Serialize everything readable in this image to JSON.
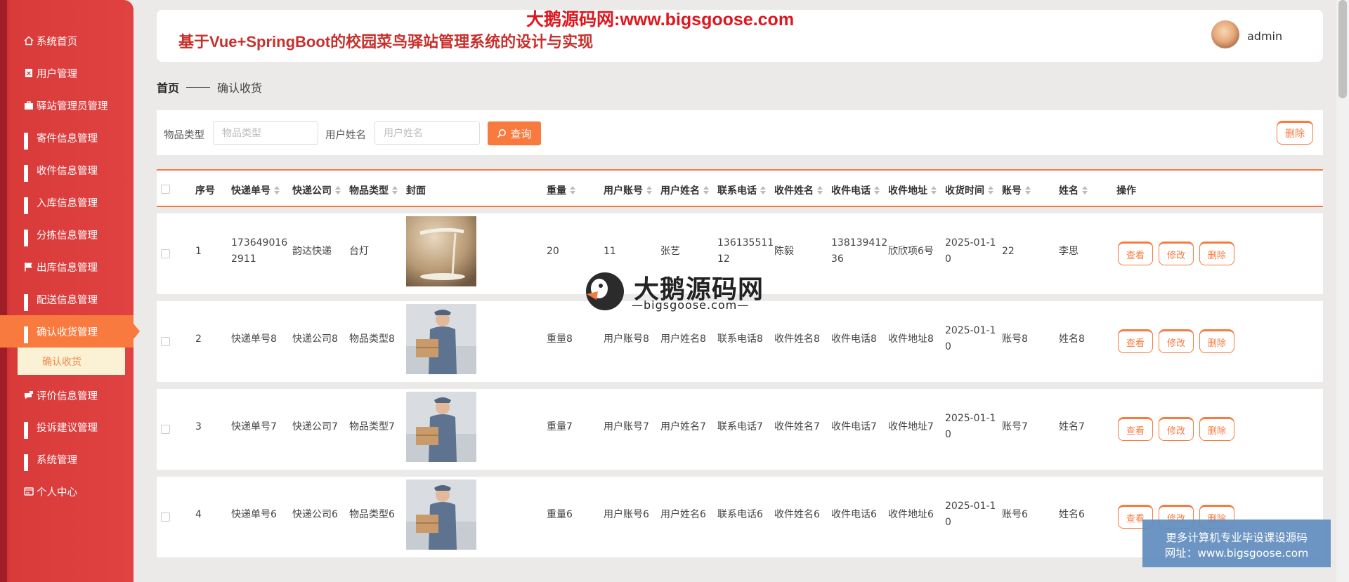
{
  "sidebar": {
    "items": [
      {
        "label": "系统首页",
        "icon": "home-icon"
      },
      {
        "label": "用户管理",
        "icon": "user-doc-icon"
      },
      {
        "label": "驿站管理员管理",
        "icon": "briefcase-icon"
      },
      {
        "label": "寄件信息管理",
        "icon": "grid-icon"
      },
      {
        "label": "收件信息管理",
        "icon": "grid-icon"
      },
      {
        "label": "入库信息管理",
        "icon": "grid-icon"
      },
      {
        "label": "分拣信息管理",
        "icon": "grid-icon"
      },
      {
        "label": "出库信息管理",
        "icon": "flag-icon"
      },
      {
        "label": "配送信息管理",
        "icon": "grid-icon"
      },
      {
        "label": "确认收货管理",
        "icon": "grid-icon"
      },
      {
        "label": "评价信息管理",
        "icon": "comment-icon"
      },
      {
        "label": "投诉建议管理",
        "icon": "grid-icon"
      },
      {
        "label": "系统管理",
        "icon": "grid-icon"
      },
      {
        "label": "个人中心",
        "icon": "card-icon"
      }
    ],
    "active_sub": "确认收货",
    "active_color": "#f97a3e"
  },
  "header": {
    "title": "基于Vue+SpringBoot的校园菜鸟驿站管理系统的设计与实现",
    "user": "admin"
  },
  "watermark": {
    "top": "大鹅源码网:www.bigsgoose.com",
    "center_title": "大鹅源码网",
    "center_sub": "—bigsgoose.com—",
    "box_line1": "更多计算机专业毕设课设源码",
    "box_line2": "网址：www.bigsgoose.com"
  },
  "breadcrumb": {
    "home": "首页",
    "current": "确认收货"
  },
  "search": {
    "type_label": "物品类型",
    "type_placeholder": "物品类型",
    "name_label": "用户姓名",
    "name_placeholder": "用户姓名",
    "query_label": "查询",
    "delete_label": "删除"
  },
  "table": {
    "headers": [
      "序号",
      "快递单号",
      "快递公司",
      "物品类型",
      "封面",
      "重量",
      "用户账号",
      "用户姓名",
      "联系电话",
      "收件姓名",
      "收件电话",
      "收件地址",
      "收货时间",
      "账号",
      "姓名",
      "操作"
    ],
    "rows": [
      {
        "no": "1",
        "tracking": [
          "173649016",
          "2911"
        ],
        "company": "韵达快递",
        "type": "台灯",
        "cover": "lamp",
        "weight": "20",
        "account": "11",
        "name": "张艺",
        "phone": [
          "136135511",
          "12"
        ],
        "rname": "陈毅",
        "rphone": [
          "138139412",
          "36"
        ],
        "raddr": "欣欣项6号",
        "time": [
          "2025-01-1",
          "0"
        ],
        "acct": "22",
        "person": "李思"
      },
      {
        "no": "2",
        "tracking": [
          "快递单号8"
        ],
        "company": "快递公司8",
        "type": "物品类型8",
        "cover": "courier",
        "weight": "重量8",
        "account": "用户账号8",
        "name": "用户姓名8",
        "phone": [
          "联系电话8"
        ],
        "rname": "收件姓名8",
        "rphone": [
          "收件电话8"
        ],
        "raddr": "收件地址8",
        "time": [
          "2025-01-1",
          "0"
        ],
        "acct": "账号8",
        "person": "姓名8"
      },
      {
        "no": "3",
        "tracking": [
          "快递单号7"
        ],
        "company": "快递公司7",
        "type": "物品类型7",
        "cover": "courier",
        "weight": "重量7",
        "account": "用户账号7",
        "name": "用户姓名7",
        "phone": [
          "联系电话7"
        ],
        "rname": "收件姓名7",
        "rphone": [
          "收件电话7"
        ],
        "raddr": "收件地址7",
        "time": [
          "2025-01-1",
          "0"
        ],
        "acct": "账号7",
        "person": "姓名7"
      },
      {
        "no": "4",
        "tracking": [
          "快递单号6"
        ],
        "company": "快递公司6",
        "type": "物品类型6",
        "cover": "courier",
        "weight": "重量6",
        "account": "用户账号6",
        "name": "用户姓名6",
        "phone": [
          "联系电话6"
        ],
        "rname": "收件姓名6",
        "rphone": [
          "收件电话6"
        ],
        "raddr": "收件地址6",
        "time": [
          "2025-01-1",
          "0"
        ],
        "acct": "账号6",
        "person": "姓名6"
      }
    ],
    "ops": [
      "查看",
      "修改",
      "删除"
    ]
  }
}
